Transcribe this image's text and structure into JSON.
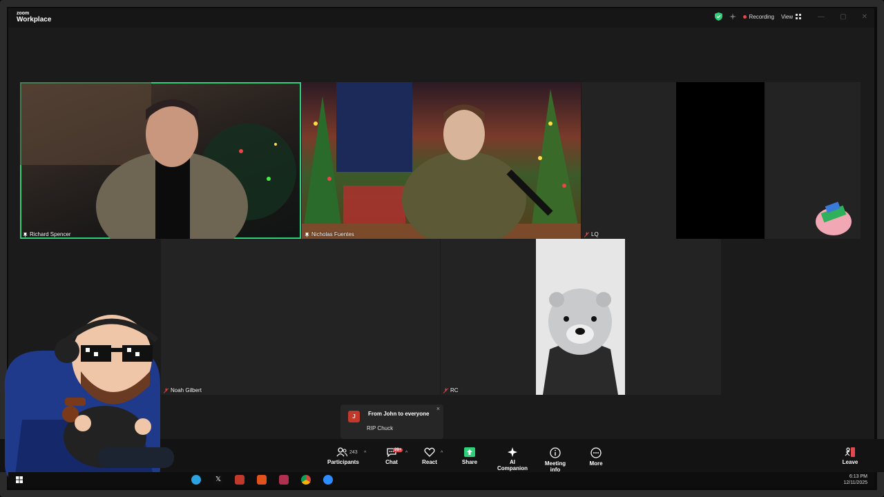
{
  "app": {
    "logo_small": "zoom",
    "logo_big": "Workplace",
    "recording_label": "Recording",
    "view_label": "View"
  },
  "participants": [
    {
      "name": "Richard Spencer"
    },
    {
      "name": "Nicholas Fuentes"
    },
    {
      "name": "LQ"
    },
    {
      "name": "Noah Gilbert"
    },
    {
      "name": "RC"
    }
  ],
  "toast": {
    "avatar_letter": "J",
    "title": "From John to everyone",
    "message": "RIP Chuck",
    "close": "×"
  },
  "toolbar": {
    "participants_label": "Participants",
    "participants_count": "243",
    "chat_label": "Chat",
    "chat_badge": "99+",
    "react_label": "React",
    "share_label": "Share",
    "ai_label": "AI Companion",
    "info_label": "Meeting info",
    "more_label": "More",
    "leave_label": "Leave"
  },
  "taskbar": {
    "time": "6:13 PM",
    "date": "12/11/2025"
  },
  "colors": {
    "active_speaker": "#2fd07a",
    "recording": "#e5484d",
    "share": "#2fd07a"
  }
}
